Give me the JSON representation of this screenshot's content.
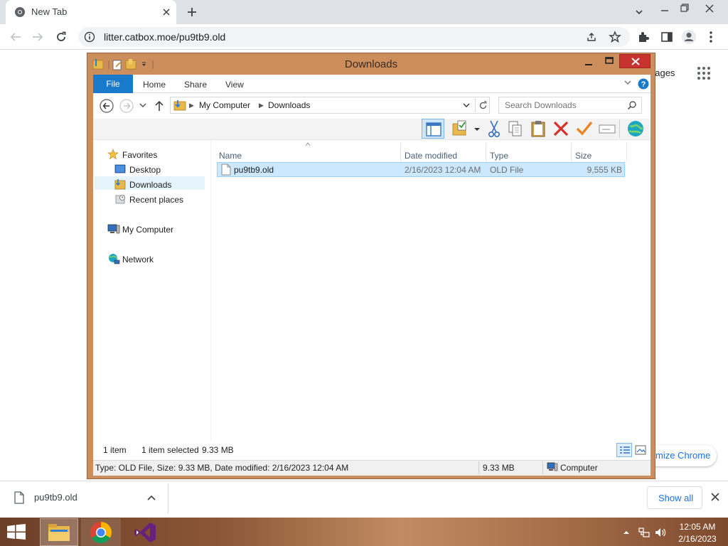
{
  "browser": {
    "tab_title": "New Tab",
    "url": "litter.catbox.moe/pu9tb9.old",
    "ntp_link_images": "nages",
    "customize_label": "mize Chrome"
  },
  "download_bar": {
    "filename": "pu9tb9.old",
    "show_all": "Show all"
  },
  "explorer": {
    "title": "Downloads",
    "ribbon_tabs": [
      "File",
      "Home",
      "Share",
      "View"
    ],
    "breadcrumb": [
      "My Computer",
      "Downloads"
    ],
    "search_placeholder": "Search Downloads",
    "nav": {
      "favorites": "Favorites",
      "desktop": "Desktop",
      "downloads": "Downloads",
      "recent": "Recent places",
      "my_computer": "My Computer",
      "network": "Network"
    },
    "columns": [
      "Name",
      "Date modified",
      "Type",
      "Size"
    ],
    "files": [
      {
        "name": "pu9tb9.old",
        "date": "2/16/2023 12:04 AM",
        "type": "OLD File",
        "size": "9,555 KB"
      }
    ],
    "status": {
      "count": "1 item",
      "selected": "1 item selected",
      "selected_size": "9.33 MB"
    },
    "details": {
      "info": "Type: OLD File, Size: 9.33 MB, Date modified: 2/16/2023 12:04 AM",
      "size": "9.33 MB",
      "location": "Computer"
    }
  },
  "taskbar": {
    "time": "12:05 AM",
    "date": "2/16/2023",
    "apps": [
      "file-explorer",
      "google-chrome",
      "visual-studio"
    ]
  },
  "colors": {
    "window_frame": "#cd8e5e",
    "file_tab": "#1979ca",
    "selection": "#cce8ff",
    "chrome_tabstrip": "#dee1e6"
  }
}
